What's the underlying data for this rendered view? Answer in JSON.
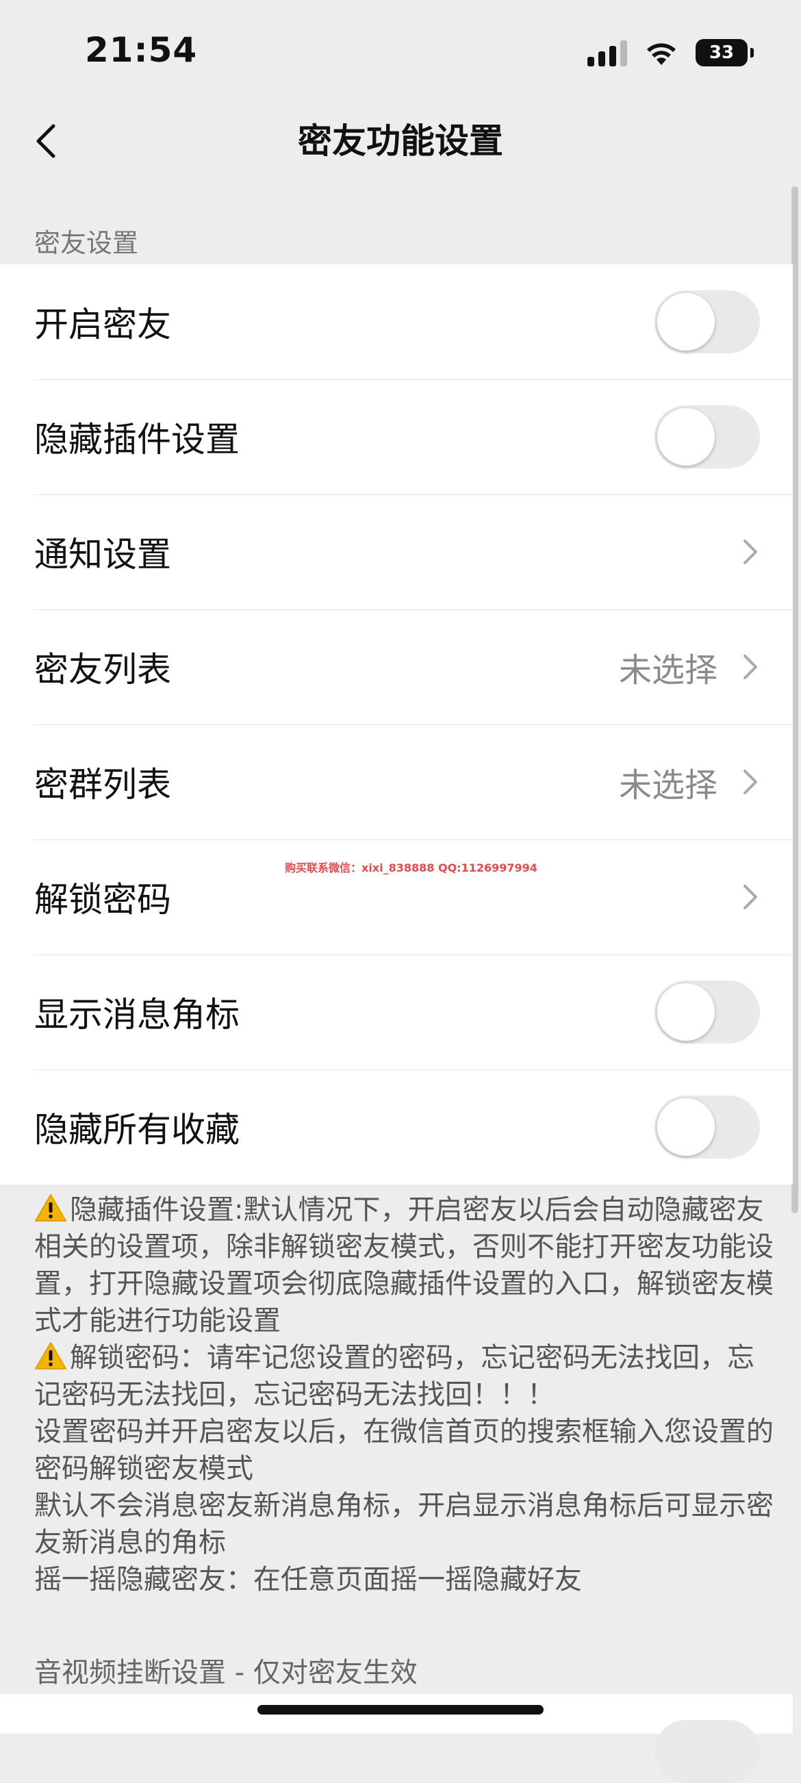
{
  "status_bar": {
    "time": "21:54",
    "battery": "33"
  },
  "nav": {
    "title": "密友功能设置"
  },
  "section1": {
    "header": "密友设置",
    "rows": [
      {
        "label": "开启密友",
        "type": "toggle",
        "on": false
      },
      {
        "label": "隐藏插件设置",
        "type": "toggle",
        "on": false
      },
      {
        "label": "通知设置",
        "type": "link"
      },
      {
        "label": "密友列表",
        "type": "link",
        "value": "未选择"
      },
      {
        "label": "密群列表",
        "type": "link",
        "value": "未选择"
      },
      {
        "label": "解锁密码",
        "type": "link"
      },
      {
        "label": "显示消息角标",
        "type": "toggle",
        "on": false
      },
      {
        "label": "隐藏所有收藏",
        "type": "toggle",
        "on": false
      }
    ]
  },
  "watermark": "购买联系微信：xixi_838888    QQ:1126997994",
  "notes": {
    "line1": "隐藏插件设置:默认情况下，开启密友以后会自动隐藏密友相关的设置项，除非解锁密友模式，否则不能打开密友功能设置，打开隐藏设置项会彻底隐藏插件设置的入口，解锁密友模式才能进行功能设置",
    "line2": "解锁密码：请牢记您设置的密码，忘记密码无法找回，忘记密码无法找回，忘记密码无法找回！！！",
    "line3": "设置密码并开启密友以后，在微信首页的搜索框输入您设置的密码解锁密友模式",
    "line4": "默认不会消息密友新消息角标，开启显示消息角标后可显示密友新消息的角标",
    "line5": "摇一摇隐藏密友：在任意页面摇一摇隐藏好友"
  },
  "section2": {
    "header": "音视频挂断设置 - 仅对密友生效"
  },
  "colors": {
    "background": "#ededed",
    "toggle_off": "#e9e9e9",
    "warning": "#f5b400",
    "watermark": "#e54b4b"
  }
}
